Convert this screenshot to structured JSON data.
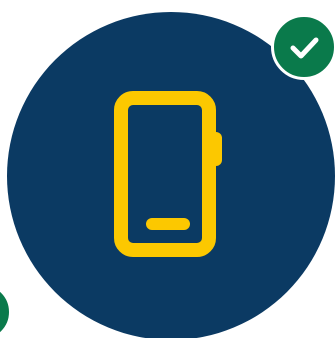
{
  "colors": {
    "circle_bg": "#0b3a63",
    "icon_stroke": "#fcc800",
    "badge_green": "#0a7a4b",
    "check_mark": "#ffffff"
  },
  "icons": {
    "main": "mobile-phone-icon",
    "badge": "checkmark-icon"
  }
}
